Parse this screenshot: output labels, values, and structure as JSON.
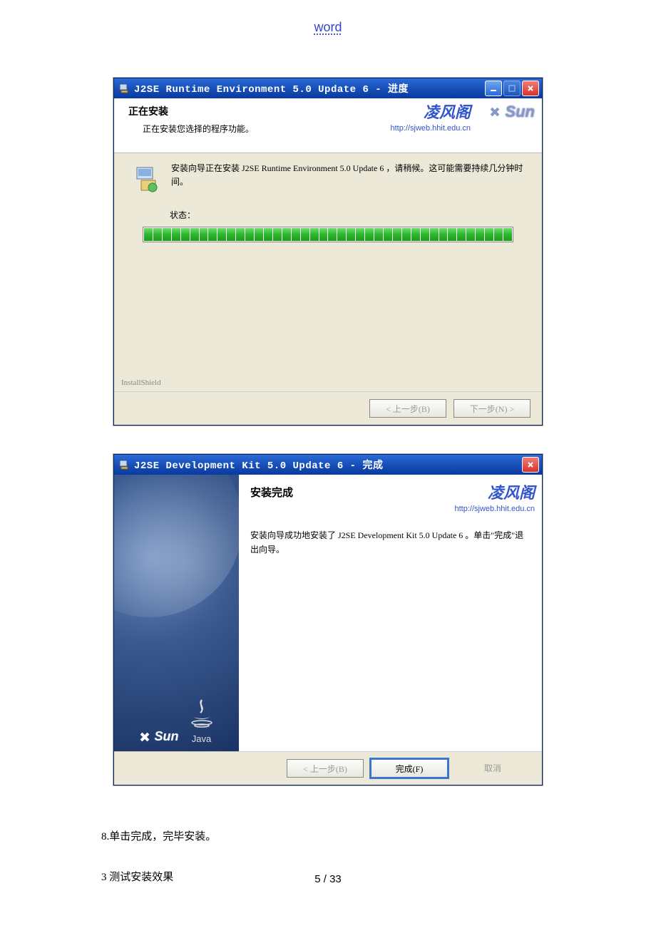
{
  "doc_header": "word",
  "installer1": {
    "title": "J2SE Runtime Environment 5.0 Update 6 - 进度",
    "header_title": "正在安装",
    "header_sub": "正在安装您选择的程序功能。",
    "brand_text": "凌风阁",
    "brand_url": "http://sjweb.hhit.edu.cn",
    "sun_label": "Sun",
    "msg": "安装向导正在安装 J2SE Runtime Environment 5.0 Update 6 ，请稍候。这可能需要持续几分钟时间。",
    "status_label": "状态：",
    "install_shield": "InstallShield",
    "btn_back": "< 上一步(B)",
    "btn_next": "下一步(N) >"
  },
  "installer2": {
    "title": "J2SE Development Kit 5.0 Update 6 - 完成",
    "header_title": "安装完成",
    "brand_text": "凌风阁",
    "brand_url": "http://sjweb.hhit.edu.cn",
    "msg": "安装向导成功地安装了 J2SE Development Kit 5.0 Update 6 。单击\"完成\"退出向导。",
    "sun_label": "Sun",
    "java_label": "Java",
    "btn_back": "< 上一步(B)",
    "btn_finish": "完成(F)",
    "btn_cancel": "取消"
  },
  "body": {
    "line1": "8.单击完成，完毕安装。",
    "line2": "3 测试安装效果"
  },
  "page_number": "5 / 33"
}
